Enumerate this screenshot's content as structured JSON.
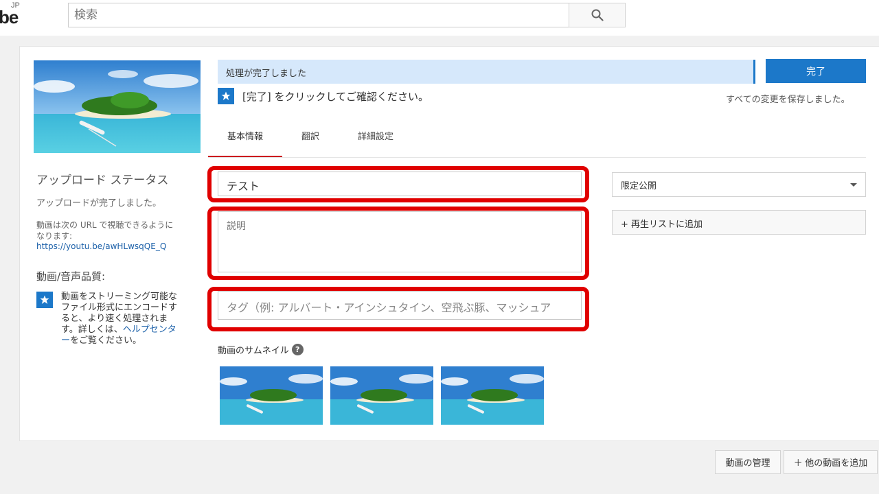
{
  "header": {
    "logo_text": "be",
    "logo_region": "JP",
    "search_placeholder": "検索"
  },
  "status": {
    "message": "処理が完了しました",
    "done_label": "完了",
    "confirm_text": "[完了] をクリックしてご確認ください。",
    "saved_text": "すべての変更を保存しました。"
  },
  "tabs": [
    {
      "label": "基本情報",
      "active": true
    },
    {
      "label": "翻訳",
      "active": false
    },
    {
      "label": "詳細設定",
      "active": false
    }
  ],
  "left": {
    "upload_title": "アップロード ステータス",
    "upload_done": "アップロードが完了しました。",
    "url_desc_1": "動画は次の URL で視聴できるように",
    "url_desc_2": "なります:",
    "url": "https://youtu.be/awHLwsqQE_Q",
    "quality_title": "動画/音声品質:",
    "quality_1": "動画をストリーミング可能な",
    "quality_2": "ファイル形式にエンコードす",
    "quality_3": "ると、より速く処理されま",
    "quality_4": "す。詳しくは、",
    "help_center_1": "ヘルプセンタ",
    "help_center_2": "ー",
    "quality_5": "をご覧ください。"
  },
  "form": {
    "title_value": "テスト",
    "description_placeholder": "説明",
    "tags_placeholder": "タグ（例: アルバート・アインシュタイン、空飛ぶ豚、マッシュア"
  },
  "side": {
    "privacy_value": "限定公開",
    "playlist_label": "+ 再生リストに追加"
  },
  "thumbnails": {
    "label": "動画のサムネイル",
    "count": 3
  },
  "footer": {
    "manage_label": "動画の管理",
    "add_more_label": "＋ 他の動画を追加"
  },
  "colors": {
    "accent": "#1c78c9",
    "status_bg": "#d6e8fb",
    "highlight": "#e00000",
    "tab_underline": "#cc181e"
  }
}
